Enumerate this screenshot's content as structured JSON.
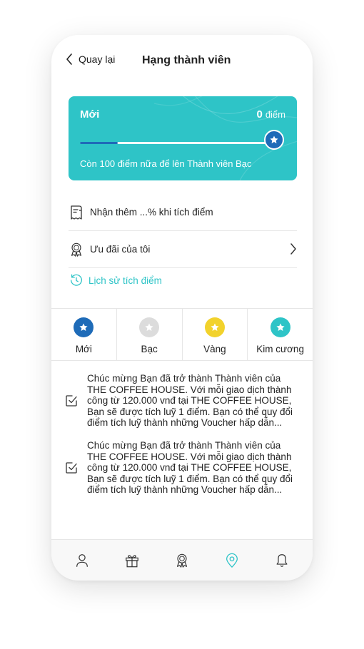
{
  "header": {
    "back_label": "Quay lại",
    "title": "Hạng thành viên"
  },
  "membership_card": {
    "tier_name": "Mới",
    "points": "0",
    "points_unit": "điểm",
    "progress_fraction": 0.2,
    "progress_text": "Còn 100 điểm nữa để lên Thành viên Bạc",
    "background_color": "#2ec4c7",
    "accent_color": "#1e6bb8"
  },
  "menu": [
    {
      "icon": "receipt-icon",
      "label": "Nhận thêm ...% khi tích điểm"
    },
    {
      "icon": "award-icon",
      "label": "Ưu đãi của tôi"
    }
  ],
  "history_link": {
    "icon": "history-icon",
    "label": "Lịch sử tích điểm"
  },
  "tiers": [
    {
      "label": "Mới",
      "color": "#1e6bb8"
    },
    {
      "label": "Bạc",
      "color": "#dcdcdc"
    },
    {
      "label": "Vàng",
      "color": "#f2d22c"
    },
    {
      "label": "Kim cương",
      "color": "#2ec4c7"
    }
  ],
  "messages": [
    {
      "icon": "checkbox-icon",
      "text": "Chúc mừng Bạn đã trở thành Thành viên của THE COFFEE HOUSE. Với mỗi giao dịch thành công từ 120.000 vnđ tại THE COFFEE HOUSE, Bạn sẽ được tích luỹ 1 điểm. Bạn có thể quy đổi điểm tích luỹ thành những Voucher hấp dẫn..."
    },
    {
      "icon": "checkbox-icon",
      "text": "Chúc mừng Bạn đã trở thành Thành viên của THE COFFEE HOUSE. Với mỗi giao dịch thành công từ 120.000 vnđ tại THE COFFEE HOUSE, Bạn sẽ được tích luỹ 1 điểm. Bạn có thể quy đổi điểm tích luỹ thành những Voucher hấp dẫn..."
    }
  ],
  "tabbar": [
    {
      "icon": "user-icon"
    },
    {
      "icon": "gift-icon"
    },
    {
      "icon": "award-icon"
    },
    {
      "icon": "location-pin-icon",
      "active": true,
      "active_color": "#2ec4c7"
    },
    {
      "icon": "bell-icon"
    }
  ]
}
